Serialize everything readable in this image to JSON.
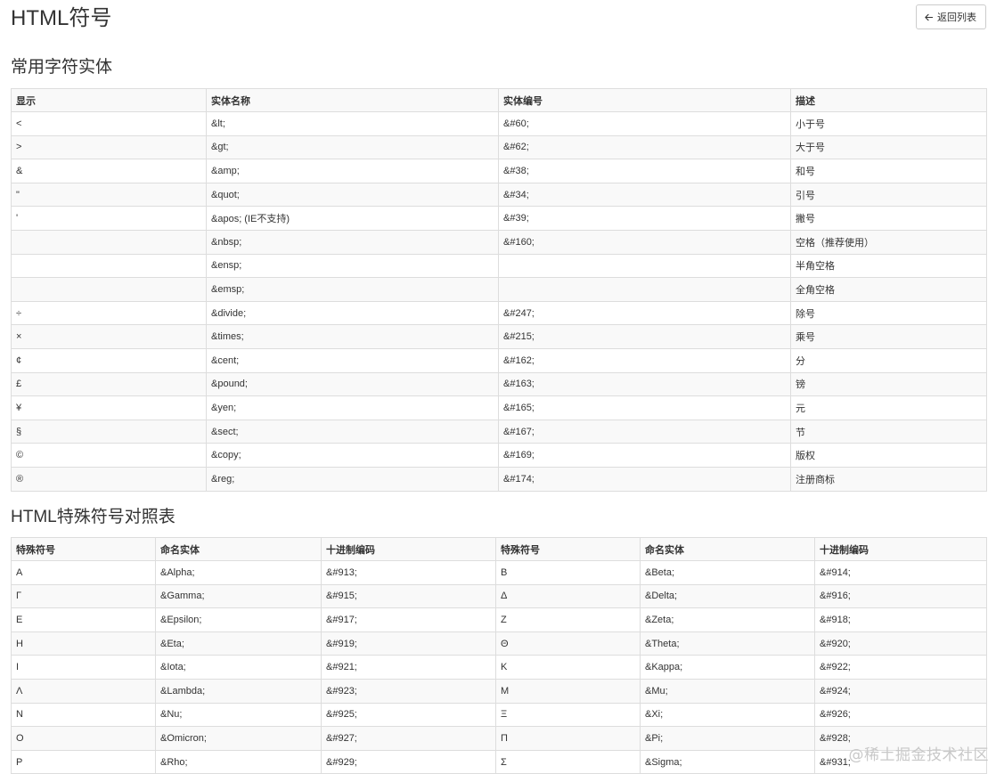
{
  "header": {
    "title": "HTML符号",
    "back_label": "返回列表"
  },
  "common_entities": {
    "title": "常用字符实体",
    "columns": [
      "显示",
      "实体名称",
      "实体编号",
      "描述"
    ],
    "rows": [
      [
        "<",
        "&lt;",
        "&#60;",
        "小于号"
      ],
      [
        ">",
        "&gt;",
        "&#62;",
        "大于号"
      ],
      [
        "&",
        "&amp;",
        "&#38;",
        "和号"
      ],
      [
        "\"",
        "&quot;",
        "&#34;",
        "引号"
      ],
      [
        "'",
        "&apos; (IE不支持)",
        "&#39;",
        "撇号"
      ],
      [
        "",
        "&nbsp;",
        "&#160;",
        "空格（推荐使用）"
      ],
      [
        "",
        "&ensp;",
        "",
        "半角空格"
      ],
      [
        "",
        "&emsp;",
        "",
        "全角空格"
      ],
      [
        "÷",
        "&divide;",
        "&#247;",
        "除号"
      ],
      [
        "×",
        "&times;",
        "&#215;",
        "乘号"
      ],
      [
        "¢",
        "&cent;",
        "&#162;",
        "分"
      ],
      [
        "£",
        "&pound;",
        "&#163;",
        "镑"
      ],
      [
        "¥",
        "&yen;",
        "&#165;",
        "元"
      ],
      [
        "§",
        "&sect;",
        "&#167;",
        "节"
      ],
      [
        "©",
        "&copy;",
        "&#169;",
        "版权"
      ],
      [
        "®",
        "&reg;",
        "&#174;",
        "注册商标"
      ]
    ]
  },
  "special_symbols": {
    "title": "HTML特殊符号对照表",
    "columns": [
      "特殊符号",
      "命名实体",
      "十进制编码",
      "特殊符号",
      "命名实体",
      "十进制编码"
    ],
    "rows": [
      [
        "Α",
        "&Alpha;",
        "&#913;",
        "Β",
        "&Beta;",
        "&#914;"
      ],
      [
        "Γ",
        "&Gamma;",
        "&#915;",
        "Δ",
        "&Delta;",
        "&#916;"
      ],
      [
        "Ε",
        "&Epsilon;",
        "&#917;",
        "Ζ",
        "&Zeta;",
        "&#918;"
      ],
      [
        "Η",
        "&Eta;",
        "&#919;",
        "Θ",
        "&Theta;",
        "&#920;"
      ],
      [
        "Ι",
        "&Iota;",
        "&#921;",
        "Κ",
        "&Kappa;",
        "&#922;"
      ],
      [
        "Λ",
        "&Lambda;",
        "&#923;",
        "Μ",
        "&Mu;",
        "&#924;"
      ],
      [
        "Ν",
        "&Nu;",
        "&#925;",
        "Ξ",
        "&Xi;",
        "&#926;"
      ],
      [
        "Ο",
        "&Omicron;",
        "&#927;",
        "Π",
        "&Pi;",
        "&#928;"
      ],
      [
        "Ρ",
        "&Rho;",
        "&#929;",
        "Σ",
        "&Sigma;",
        "&#931;"
      ]
    ]
  },
  "watermark": "@稀土掘金技术社区",
  "icons": {
    "back": "arrow-left-icon"
  }
}
